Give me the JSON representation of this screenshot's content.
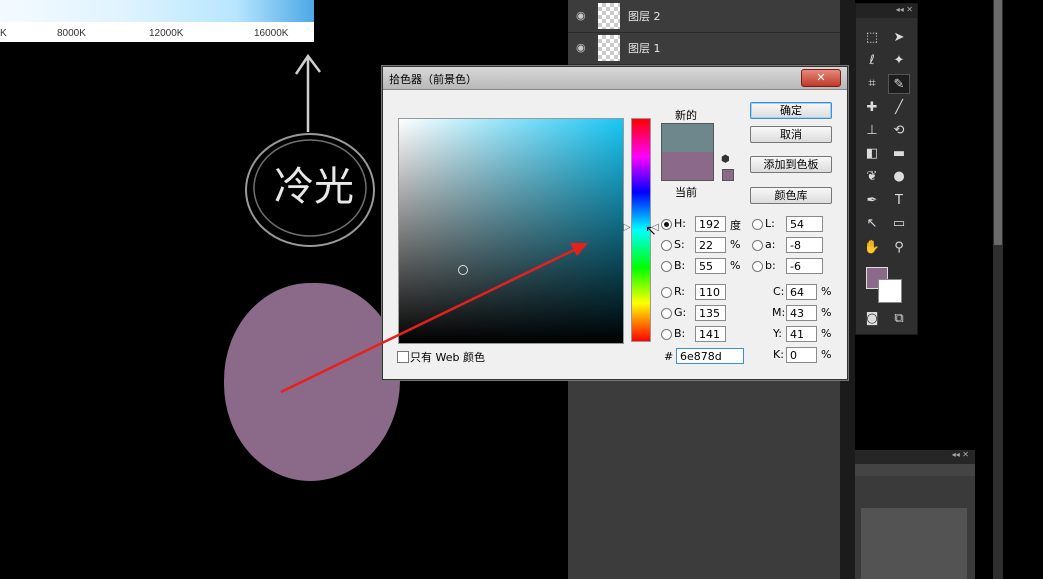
{
  "kelvin_scale": {
    "ticks": [
      "K",
      "8000K",
      "12000K",
      "16000K"
    ]
  },
  "canvas": {
    "sketch_text": "冷光",
    "blob_color": "#8a6a88"
  },
  "layers": [
    {
      "name": "图层 2"
    },
    {
      "name": "图层 1"
    }
  ],
  "dialog": {
    "title": "拾色器（前景色）",
    "close_symbol": "✕",
    "new_label": "新的",
    "current_label": "当前",
    "new_color": "#6e878d",
    "current_color": "#8a6a88",
    "buttons": {
      "ok": "确定",
      "cancel": "取消",
      "add_swatch": "添加到色板",
      "libraries": "颜色库"
    },
    "hsb": {
      "H": {
        "label": "H:",
        "value": "192",
        "unit": "度"
      },
      "S": {
        "label": "S:",
        "value": "22",
        "unit": "%"
      },
      "B": {
        "label": "B:",
        "value": "55",
        "unit": "%"
      }
    },
    "lab": {
      "L": {
        "label": "L:",
        "value": "54"
      },
      "a": {
        "label": "a:",
        "value": "-8"
      },
      "b": {
        "label": "b:",
        "value": "-6"
      }
    },
    "rgb": {
      "R": {
        "label": "R:",
        "value": "110"
      },
      "G": {
        "label": "G:",
        "value": "135"
      },
      "B": {
        "label": "B:",
        "value": "141"
      }
    },
    "cmyk": {
      "C": {
        "label": "C:",
        "value": "64",
        "unit": "%"
      },
      "M": {
        "label": "M:",
        "value": "43",
        "unit": "%"
      },
      "Y": {
        "label": "Y:",
        "value": "41",
        "unit": "%"
      },
      "K": {
        "label": "K:",
        "value": "0",
        "unit": "%"
      }
    },
    "hex": {
      "label": "#",
      "value": "6e878d"
    },
    "web_only_label": "只有 Web 颜色",
    "selected_mode": "H"
  },
  "tools_header": "◂◂ ✕",
  "right_panel_header": "◂◂ ✕",
  "annotation": {
    "arrow_color": "#e8201c"
  }
}
